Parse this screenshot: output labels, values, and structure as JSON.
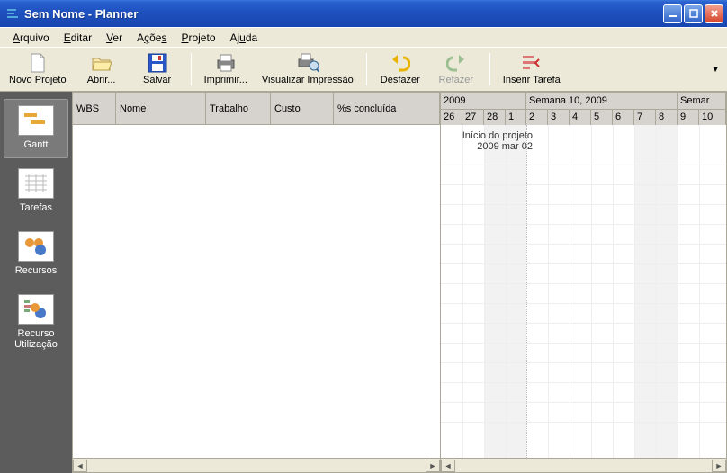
{
  "window": {
    "title": "Sem Nome - Planner"
  },
  "menu": [
    "Arquivo",
    "Editar",
    "Ver",
    "Ações",
    "Projeto",
    "Ajuda"
  ],
  "toolbar": {
    "new": "Novo Projeto",
    "open": "Abrir...",
    "save": "Salvar",
    "print": "Imprimir...",
    "preview": "Visualizar Impressão",
    "undo": "Desfazer",
    "redo": "Refazer",
    "insert": "Inserir Tarefa"
  },
  "sidebar": {
    "gantt": "Gantt",
    "tasks": "Tarefas",
    "resources": "Recursos",
    "usage_l1": "Recurso",
    "usage_l2": "Utilização"
  },
  "columns": {
    "wbs": "WBS",
    "name": "Nome",
    "work": "Trabalho",
    "cost": "Custo",
    "pct": "%s concluída"
  },
  "timeline": {
    "left_header": "2009",
    "mid_header": "Semana 10, 2009",
    "right_header": "Semar",
    "days_left": [
      "26",
      "27",
      "28",
      "1"
    ],
    "days_mid": [
      "2",
      "3",
      "4",
      "5",
      "6",
      "7",
      "8"
    ],
    "days_right": [
      "9",
      "10"
    ],
    "project_start_l1": "Início do projeto",
    "project_start_l2": "2009 mar 02"
  }
}
